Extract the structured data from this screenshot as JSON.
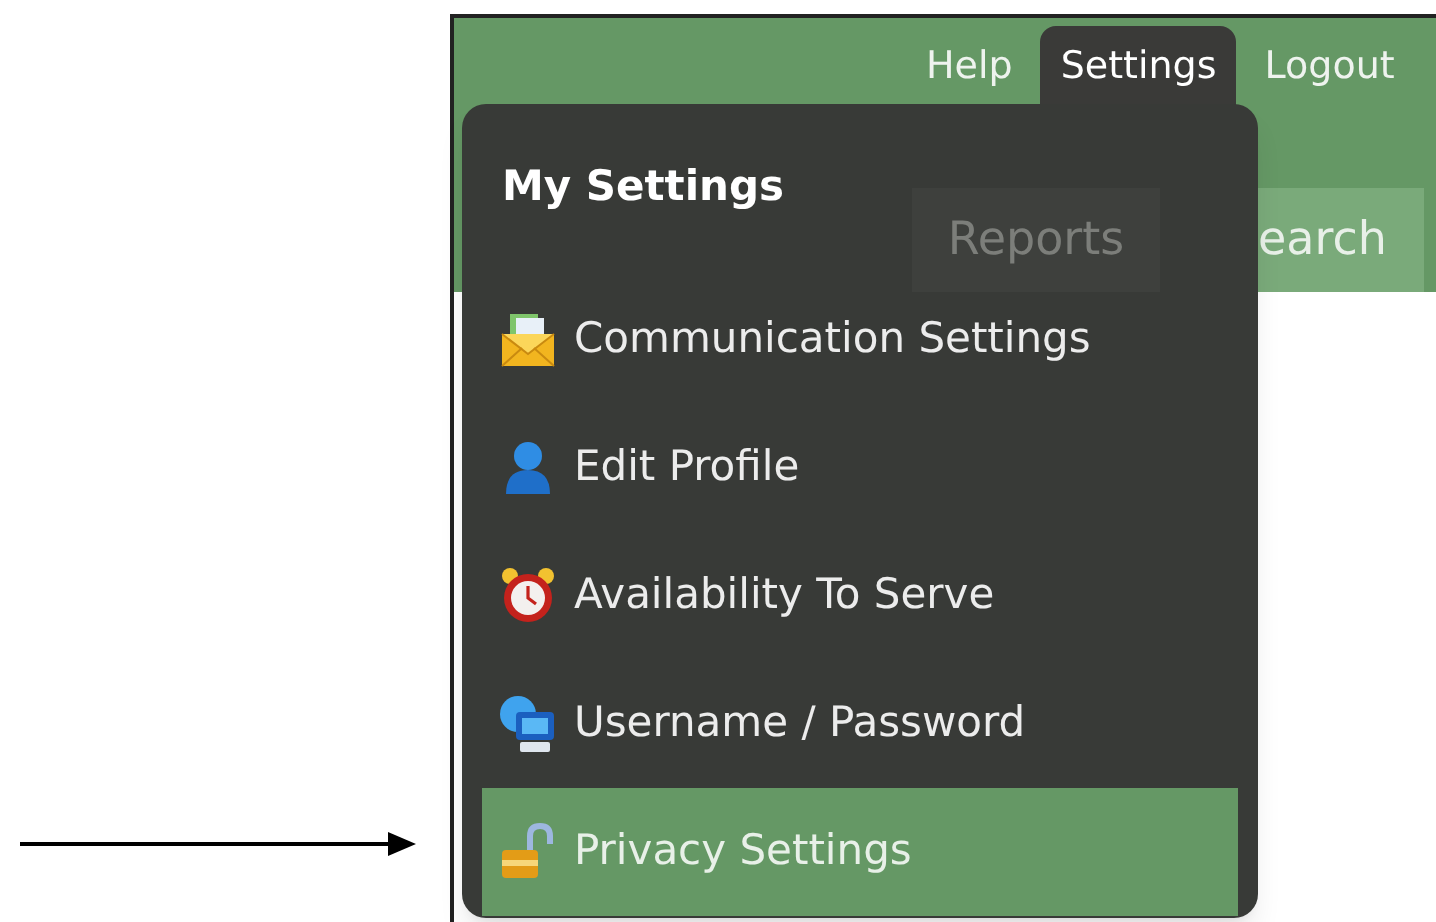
{
  "nav": [
    {
      "label": "Help",
      "selected": false
    },
    {
      "label": "Settings",
      "selected": true
    },
    {
      "label": "Logout",
      "selected": false
    }
  ],
  "tabs": [
    {
      "label": "Reports"
    },
    {
      "label": "earch"
    }
  ],
  "menu": {
    "title": "My Settings",
    "items": [
      {
        "label": "Communication Settings",
        "kind": "envelope",
        "selected": false
      },
      {
        "label": "Edit Profile",
        "kind": "person",
        "selected": false
      },
      {
        "label": "Availability To Serve",
        "kind": "clock",
        "selected": false
      },
      {
        "label": "Username / Password",
        "kind": "monitor",
        "selected": false
      },
      {
        "label": "Privacy Settings",
        "kind": "lock",
        "selected": true
      }
    ]
  }
}
